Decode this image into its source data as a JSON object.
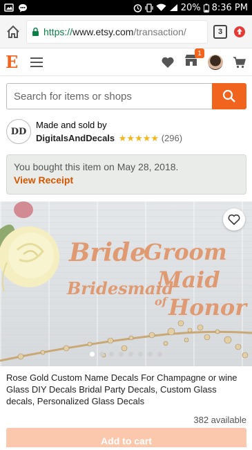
{
  "status": {
    "battery": "20%",
    "time": "8:36 PM"
  },
  "browser": {
    "url_scheme": "https://",
    "url_domain": "www.etsy.com",
    "url_path": "/transaction/",
    "tab_count": "3"
  },
  "header": {
    "logo": "E",
    "cart_badge": "1"
  },
  "search": {
    "placeholder": "Search for items or shops"
  },
  "seller": {
    "logo_text": "DD",
    "made_by": "Made and sold by",
    "name": "DigitalsAndDecals",
    "stars": "★★★★★",
    "reviews": "(296)"
  },
  "purchase": {
    "message": "You bought this item on May 28, 2018.",
    "receipt_link": "View Receipt"
  },
  "image": {
    "overlay": [
      "Bride",
      "Groom",
      "Bridesmaid",
      "Maid",
      "of",
      "Honor"
    ],
    "dots": [
      true,
      false,
      false,
      false,
      false,
      false,
      false,
      false
    ]
  },
  "product": {
    "title": "Rose Gold Custom Name Decals For Champagne or wine Glass DIY Decals Bridal Party Decals, Custom Glass decals, Personalized Glass Decals",
    "available": "382 available",
    "add_to_cart": "Add to cart"
  },
  "colors": {
    "accent": "#f1641e",
    "link": "#d65600",
    "star": "#f1b61e"
  }
}
